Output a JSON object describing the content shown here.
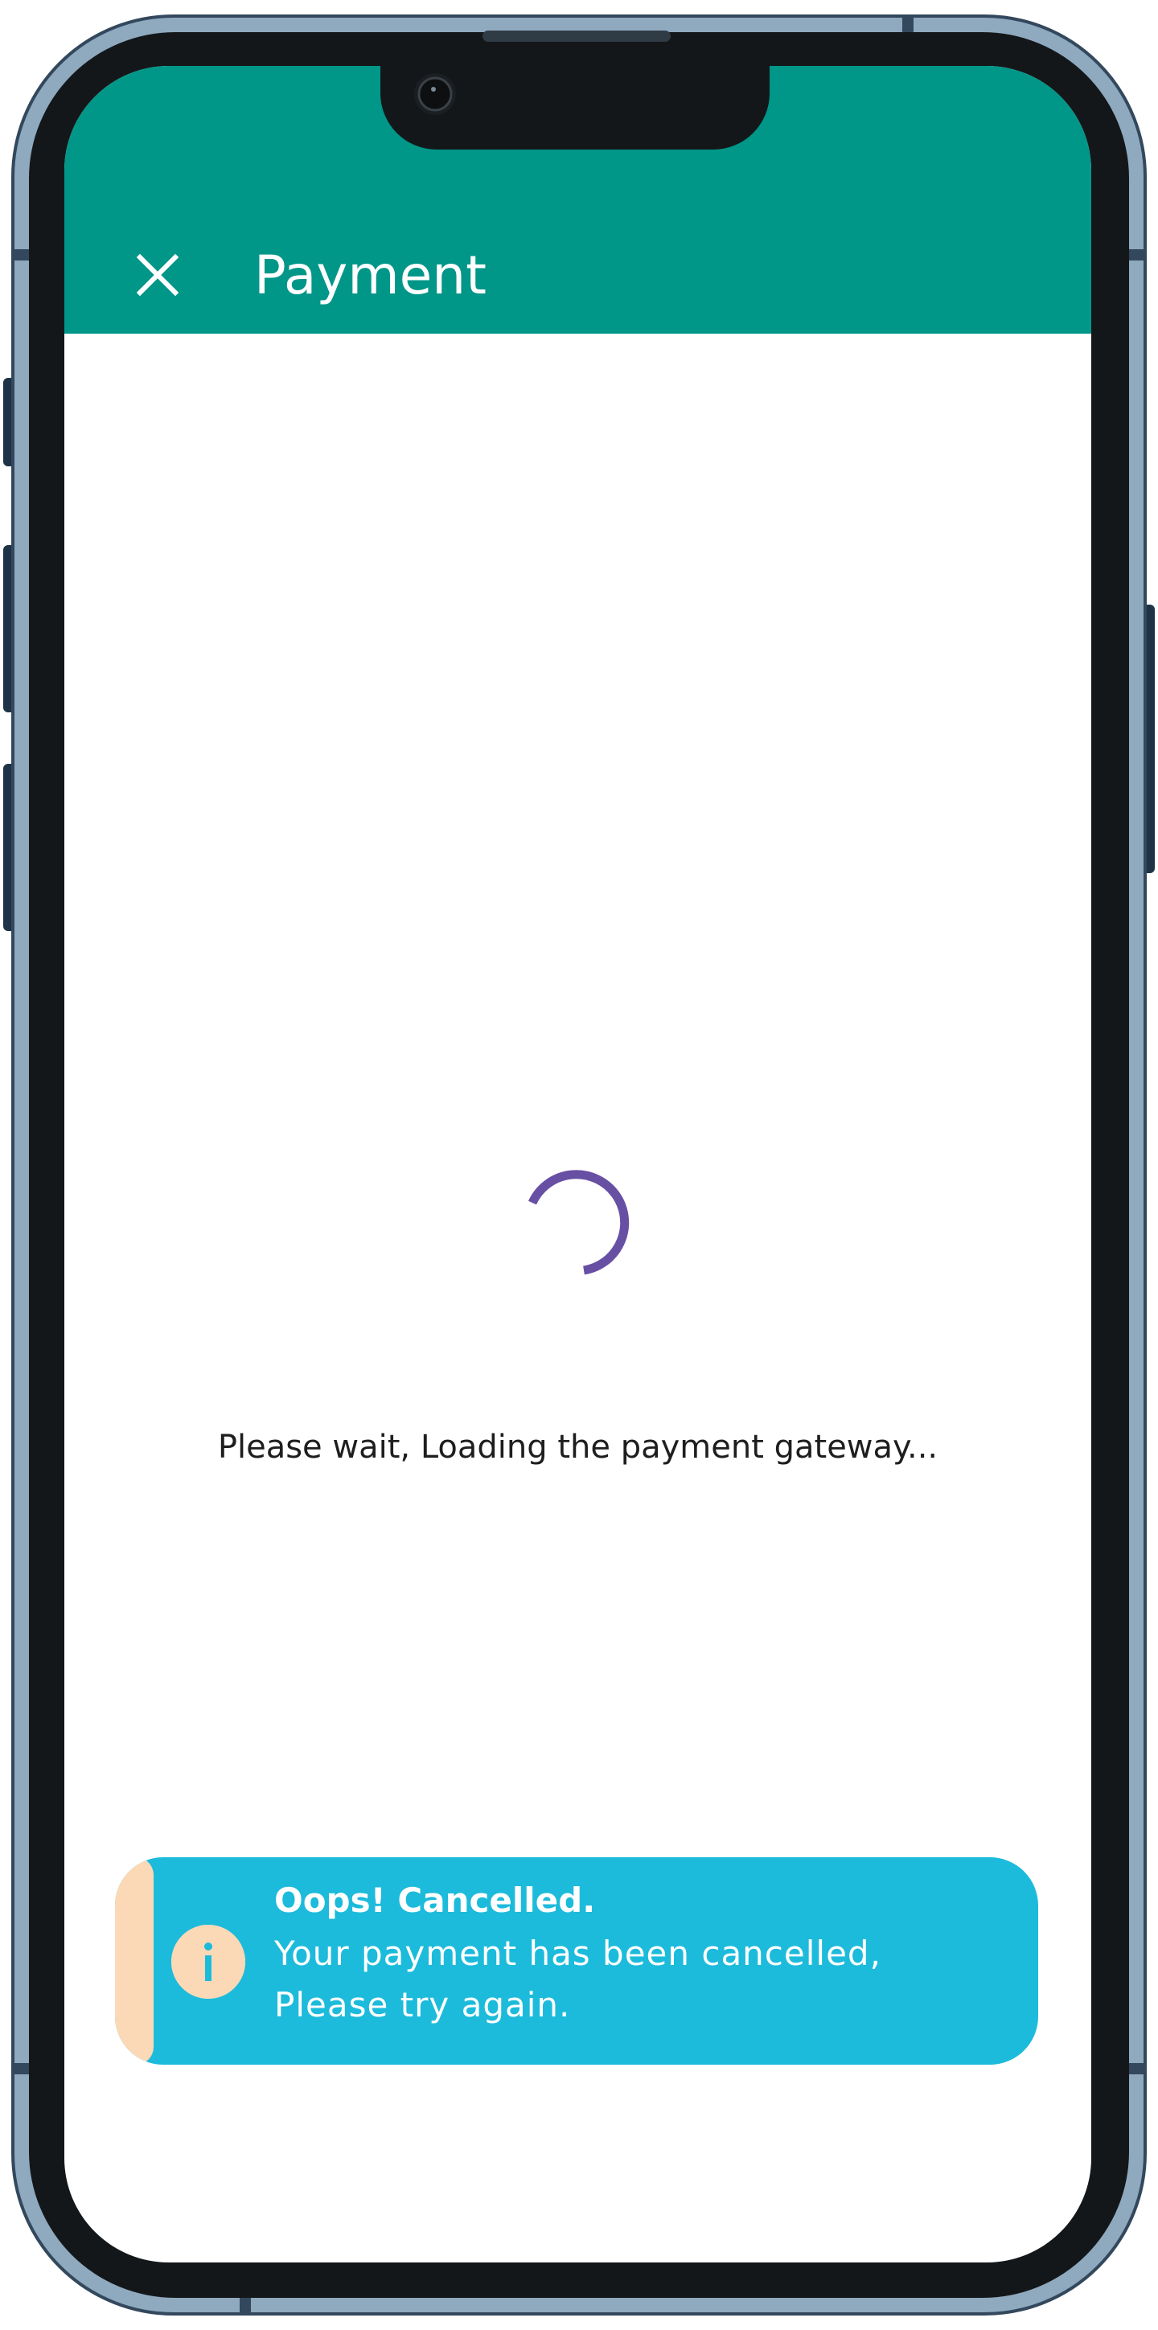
{
  "header": {
    "title": "Payment",
    "close_icon": "close-icon"
  },
  "main": {
    "loading_message": "Please wait, Loading the payment gateway...",
    "spinner_icon": "loading-spinner-icon"
  },
  "snackbar": {
    "title": "Oops! Cancelled.",
    "message": "Your payment has been cancelled, Please try again.",
    "icon": "info-icon"
  },
  "colors": {
    "app_bar": "#009688",
    "spinner": "#6750A4",
    "snackbar_bg": "#1CBBDB",
    "snackbar_accent": "#FCD9B6",
    "text_dark": "#1E1E1E",
    "device_frame": "#8FA9BF",
    "device_bezel": "#141719"
  }
}
